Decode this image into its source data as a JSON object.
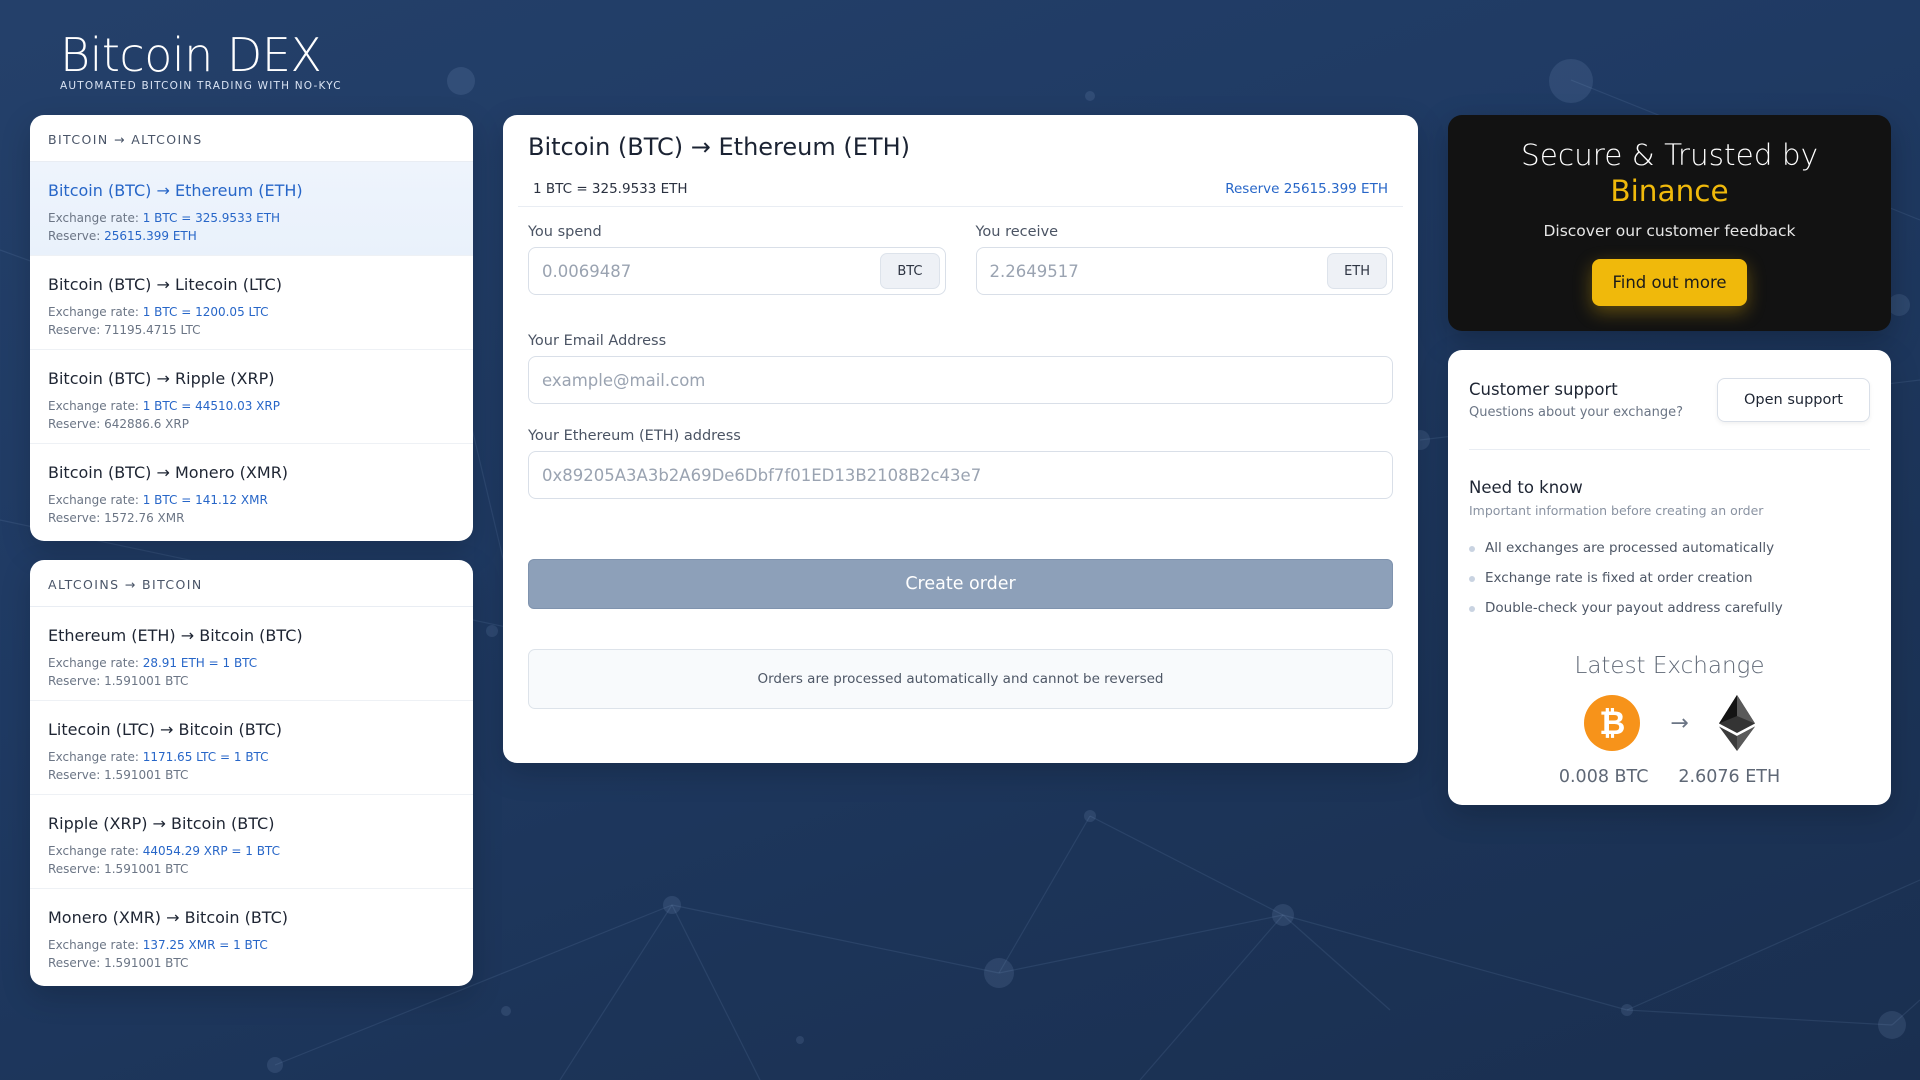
{
  "brand": {
    "title": "Bitcoin DEX",
    "subtitle": "AUTOMATED BITCOIN TRADING WITH NO-KYC"
  },
  "btc_to_alt": {
    "heading": "BITCOIN → ALTCOINS",
    "items": [
      {
        "name": "Bitcoin (BTC) → Ethereum (ETH)",
        "rate_label": "Exchange rate:",
        "rate": "1 BTC = 325.9533 ETH",
        "reserve_label": "Reserve:",
        "reserve": "25615.399 ETH"
      },
      {
        "name": "Bitcoin (BTC) → Litecoin (LTC)",
        "rate_label": "Exchange rate:",
        "rate": "1 BTC = 1200.05 LTC",
        "reserve_label": "Reserve:",
        "reserve": "71195.4715 LTC"
      },
      {
        "name": "Bitcoin (BTC) → Ripple (XRP)",
        "rate_label": "Exchange rate:",
        "rate": "1 BTC = 44510.03 XRP",
        "reserve_label": "Reserve:",
        "reserve": "642886.6 XRP"
      },
      {
        "name": "Bitcoin (BTC) → Monero (XMR)",
        "rate_label": "Exchange rate:",
        "rate": "1 BTC = 141.12 XMR",
        "reserve_label": "Reserve:",
        "reserve": "1572.76 XMR"
      }
    ]
  },
  "alt_to_btc": {
    "heading": "ALTCOINS → BITCOIN",
    "items": [
      {
        "name": "Ethereum (ETH) → Bitcoin (BTC)",
        "rate_label": "Exchange rate:",
        "rate": "28.91 ETH = 1 BTC",
        "reserve_label": "Reserve:",
        "reserve": "1.591001 BTC"
      },
      {
        "name": "Litecoin (LTC) → Bitcoin (BTC)",
        "rate_label": "Exchange rate:",
        "rate": "1171.65 LTC = 1 BTC",
        "reserve_label": "Reserve:",
        "reserve": "1.591001 BTC"
      },
      {
        "name": "Ripple (XRP) → Bitcoin (BTC)",
        "rate_label": "Exchange rate:",
        "rate": "44054.29 XRP = 1 BTC",
        "reserve_label": "Reserve:",
        "reserve": "1.591001 BTC"
      },
      {
        "name": "Monero (XMR) → Bitcoin (BTC)",
        "rate_label": "Exchange rate:",
        "rate": "137.25 XMR = 1 BTC",
        "reserve_label": "Reserve:",
        "reserve": "1.591001 BTC"
      }
    ]
  },
  "order": {
    "title": "Bitcoin (BTC) → Ethereum (ETH)",
    "rate_line": "1 BTC = 325.9533 ETH",
    "reserve_label": "Reserve",
    "reserve_value": "25615.399 ETH",
    "spend_label": "You spend",
    "spend_value": "0.0069487",
    "spend_currency": "BTC",
    "receive_label": "You receive",
    "receive_value": "2.2649517",
    "receive_currency": "ETH",
    "email_label": "Your Email Address",
    "email_placeholder": "example@mail.com",
    "address_label": "Your Ethereum (ETH) address",
    "address_placeholder": "0x89205A3A3b2A69De6Dbf7f01ED13B2108B2c43e7",
    "create_label": "Create order",
    "note": "Orders are processed automatically and cannot be reversed"
  },
  "promo": {
    "title": "Secure & Trusted by",
    "brand": "Binance",
    "subtitle": "Discover our customer feedback",
    "button": "Find out more",
    "accent": "#f0b90b"
  },
  "support": {
    "title": "Customer support",
    "subtitle": "Questions about your exchange?",
    "button": "Open support",
    "ntk_title": "Need to know",
    "ntk_subtitle": "Important information before creating an order",
    "ntk_items": [
      "All exchanges are processed automatically",
      "Exchange rate is fixed at order creation",
      "Double-check your payout address carefully"
    ],
    "latest_title": "Latest Exchange",
    "from_amount": "0.008 BTC",
    "to_amount": "2.6076 ETH"
  },
  "icons": {
    "from": "bitcoin-icon",
    "arrow": "arrow-right-icon",
    "to": "ethereum-icon"
  },
  "colors": {
    "bitcoin": "#f7931a",
    "link_blue": "#2766c8",
    "button_disabled": "#8da0b9"
  }
}
